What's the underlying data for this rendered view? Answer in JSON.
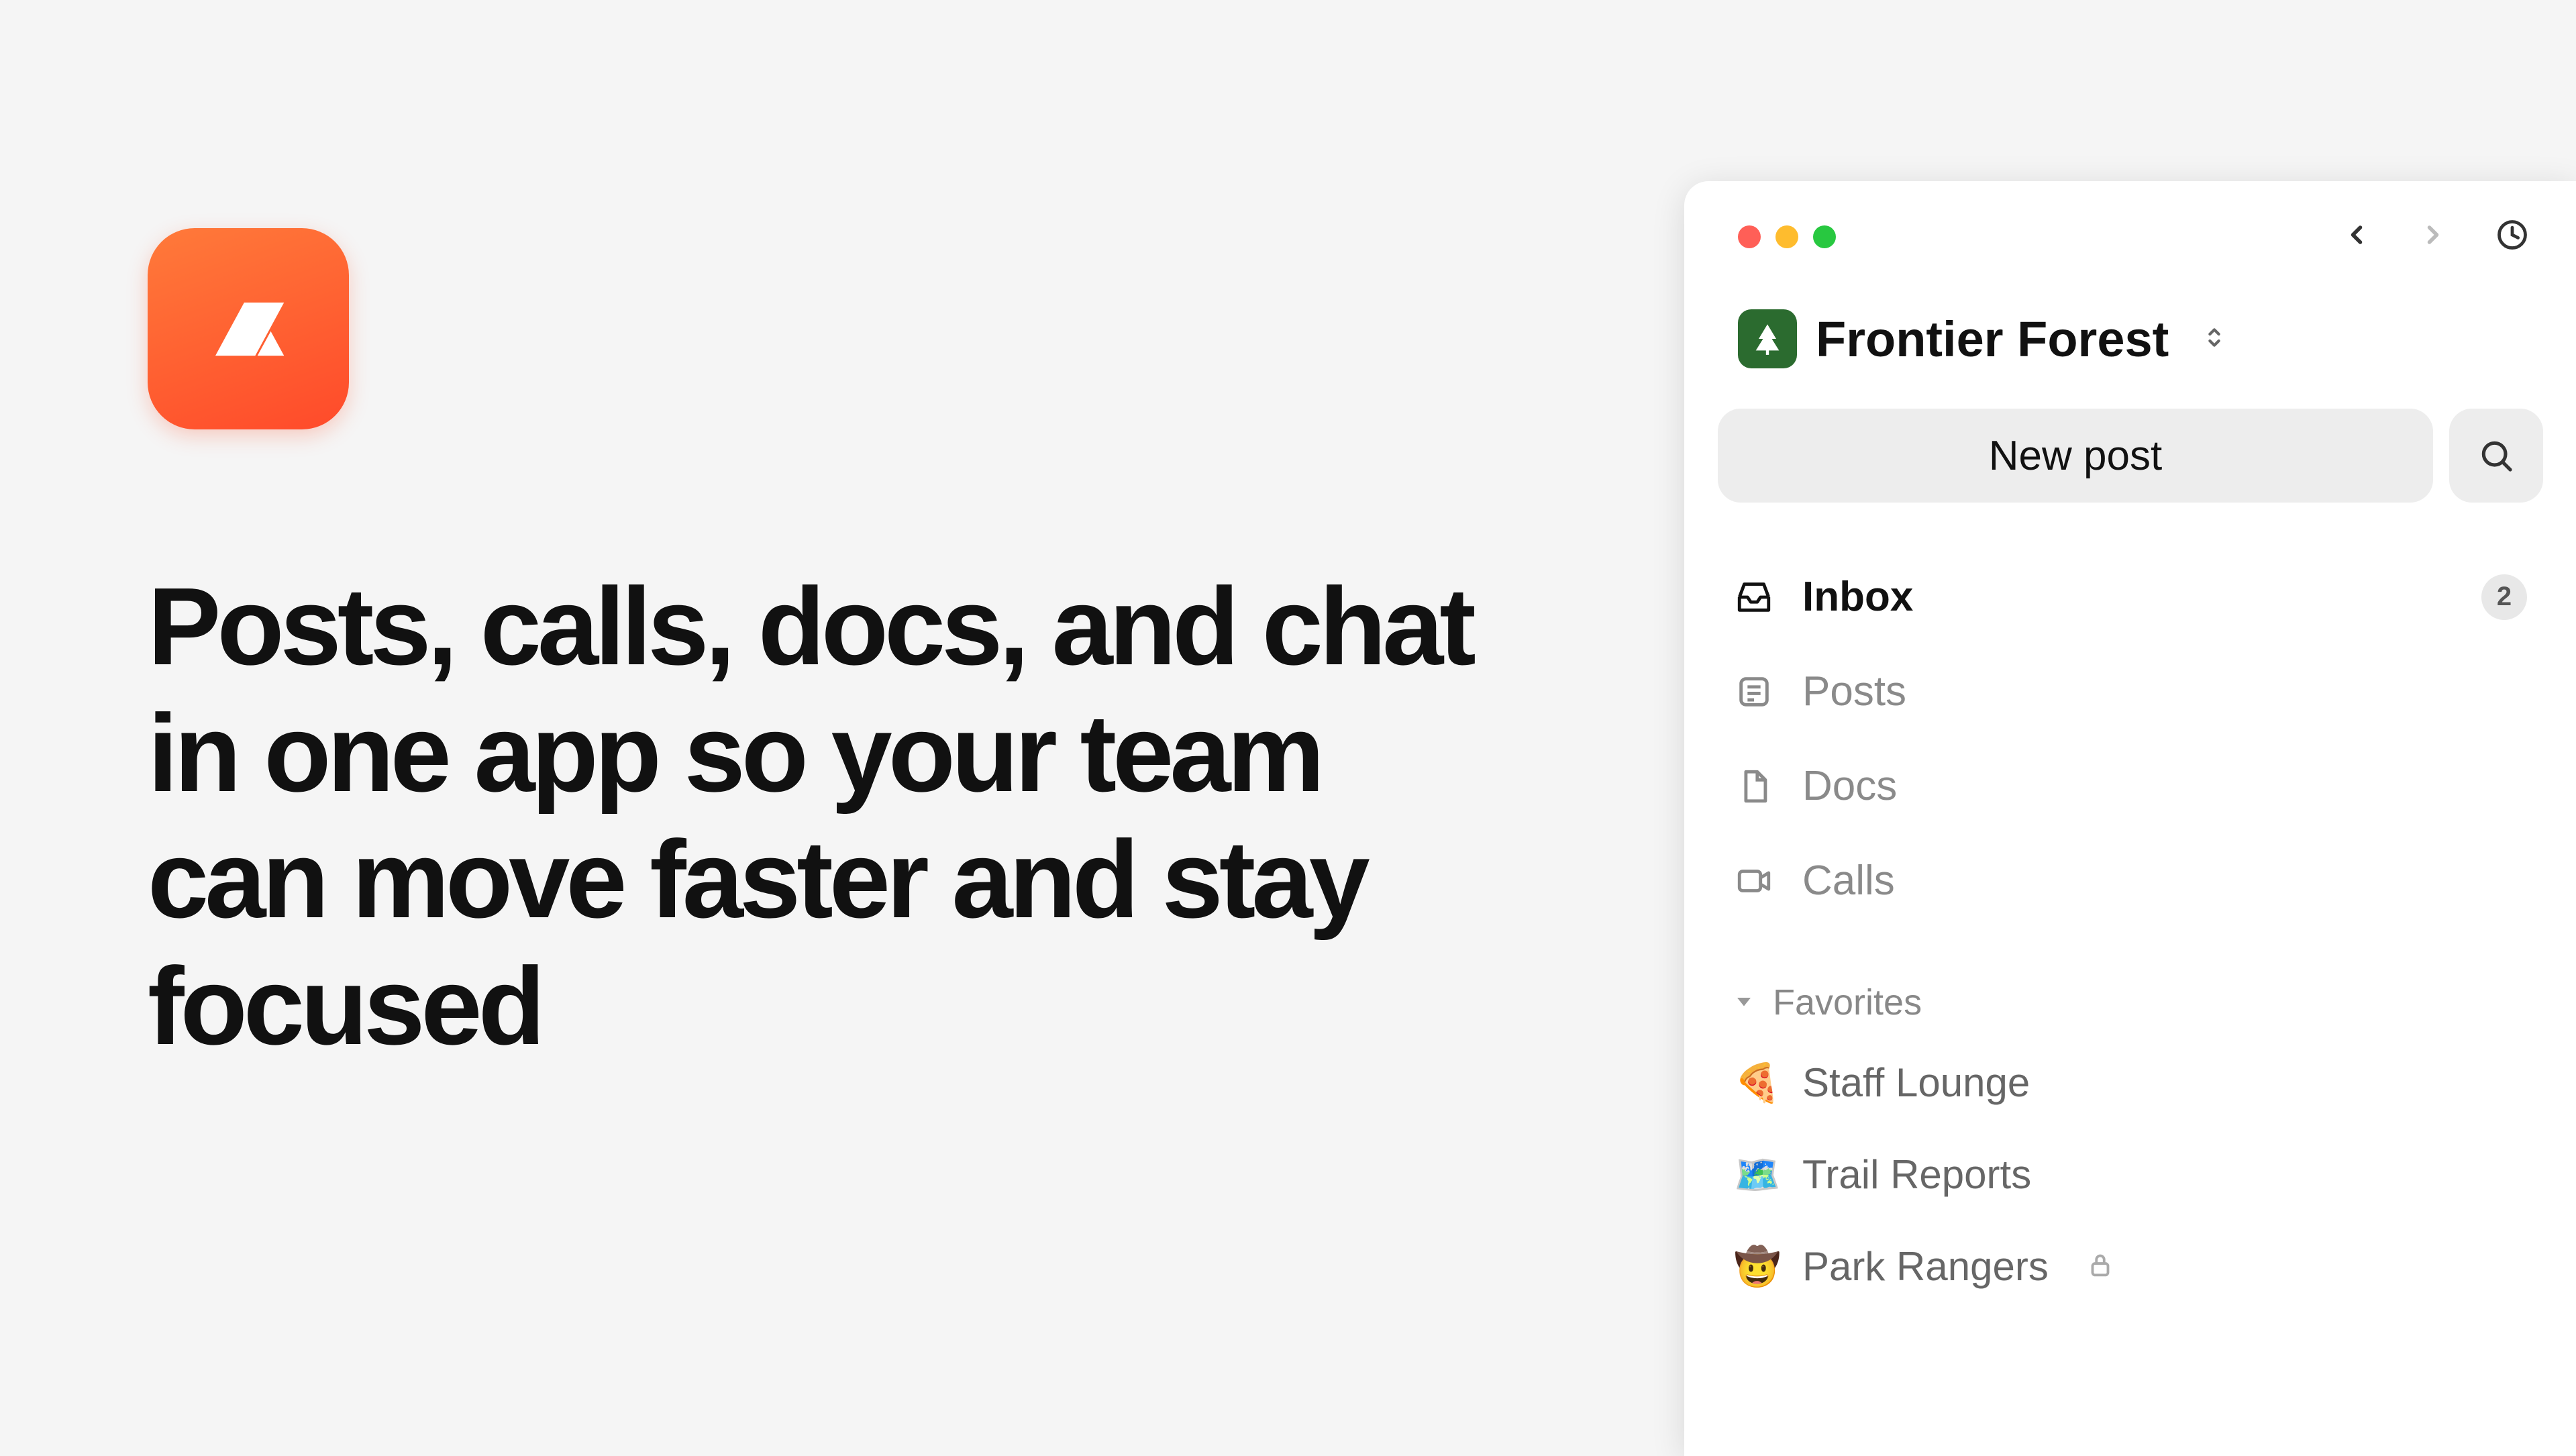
{
  "hero": {
    "headline": "Posts, calls, docs, and chat in one app so your team can move faster and stay focused"
  },
  "workspace": {
    "name": "Frontier Forest"
  },
  "new_post_label": "New post",
  "nav": {
    "inbox": {
      "label": "Inbox",
      "badge": "2"
    },
    "posts": {
      "label": "Posts"
    },
    "docs": {
      "label": "Docs"
    },
    "calls": {
      "label": "Calls"
    }
  },
  "sections": {
    "favorites": {
      "title": "Favorites",
      "items": [
        {
          "emoji": "🍕",
          "label": "Staff Lounge",
          "locked": false
        },
        {
          "emoji": "🗺️",
          "label": "Trail Reports",
          "locked": false
        },
        {
          "emoji": "🤠",
          "label": "Park Rangers",
          "locked": true
        }
      ]
    }
  }
}
